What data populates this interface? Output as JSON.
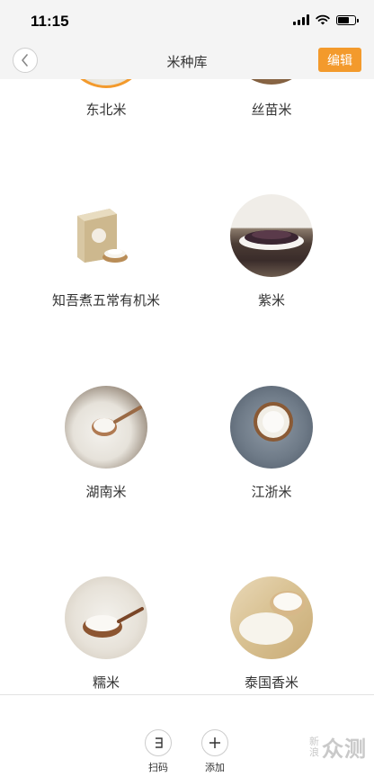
{
  "status_bar": {
    "time": "11:15"
  },
  "nav": {
    "title": "米种库",
    "edit_label": "编辑"
  },
  "rice_varieties": [
    {
      "name": "东北米"
    },
    {
      "name": "丝苗米"
    },
    {
      "name": "知吾煮五常有机米"
    },
    {
      "name": "紫米"
    },
    {
      "name": "湖南米"
    },
    {
      "name": "江浙米"
    },
    {
      "name": "糯米"
    },
    {
      "name": "泰国香米"
    }
  ],
  "toolbar": {
    "scan_label": "扫码",
    "add_label": "添加"
  },
  "watermark": {
    "small_text": "新浪",
    "big_text": "众测"
  },
  "colors": {
    "accent": "#f39a2c",
    "background": "#f4f4f4"
  }
}
